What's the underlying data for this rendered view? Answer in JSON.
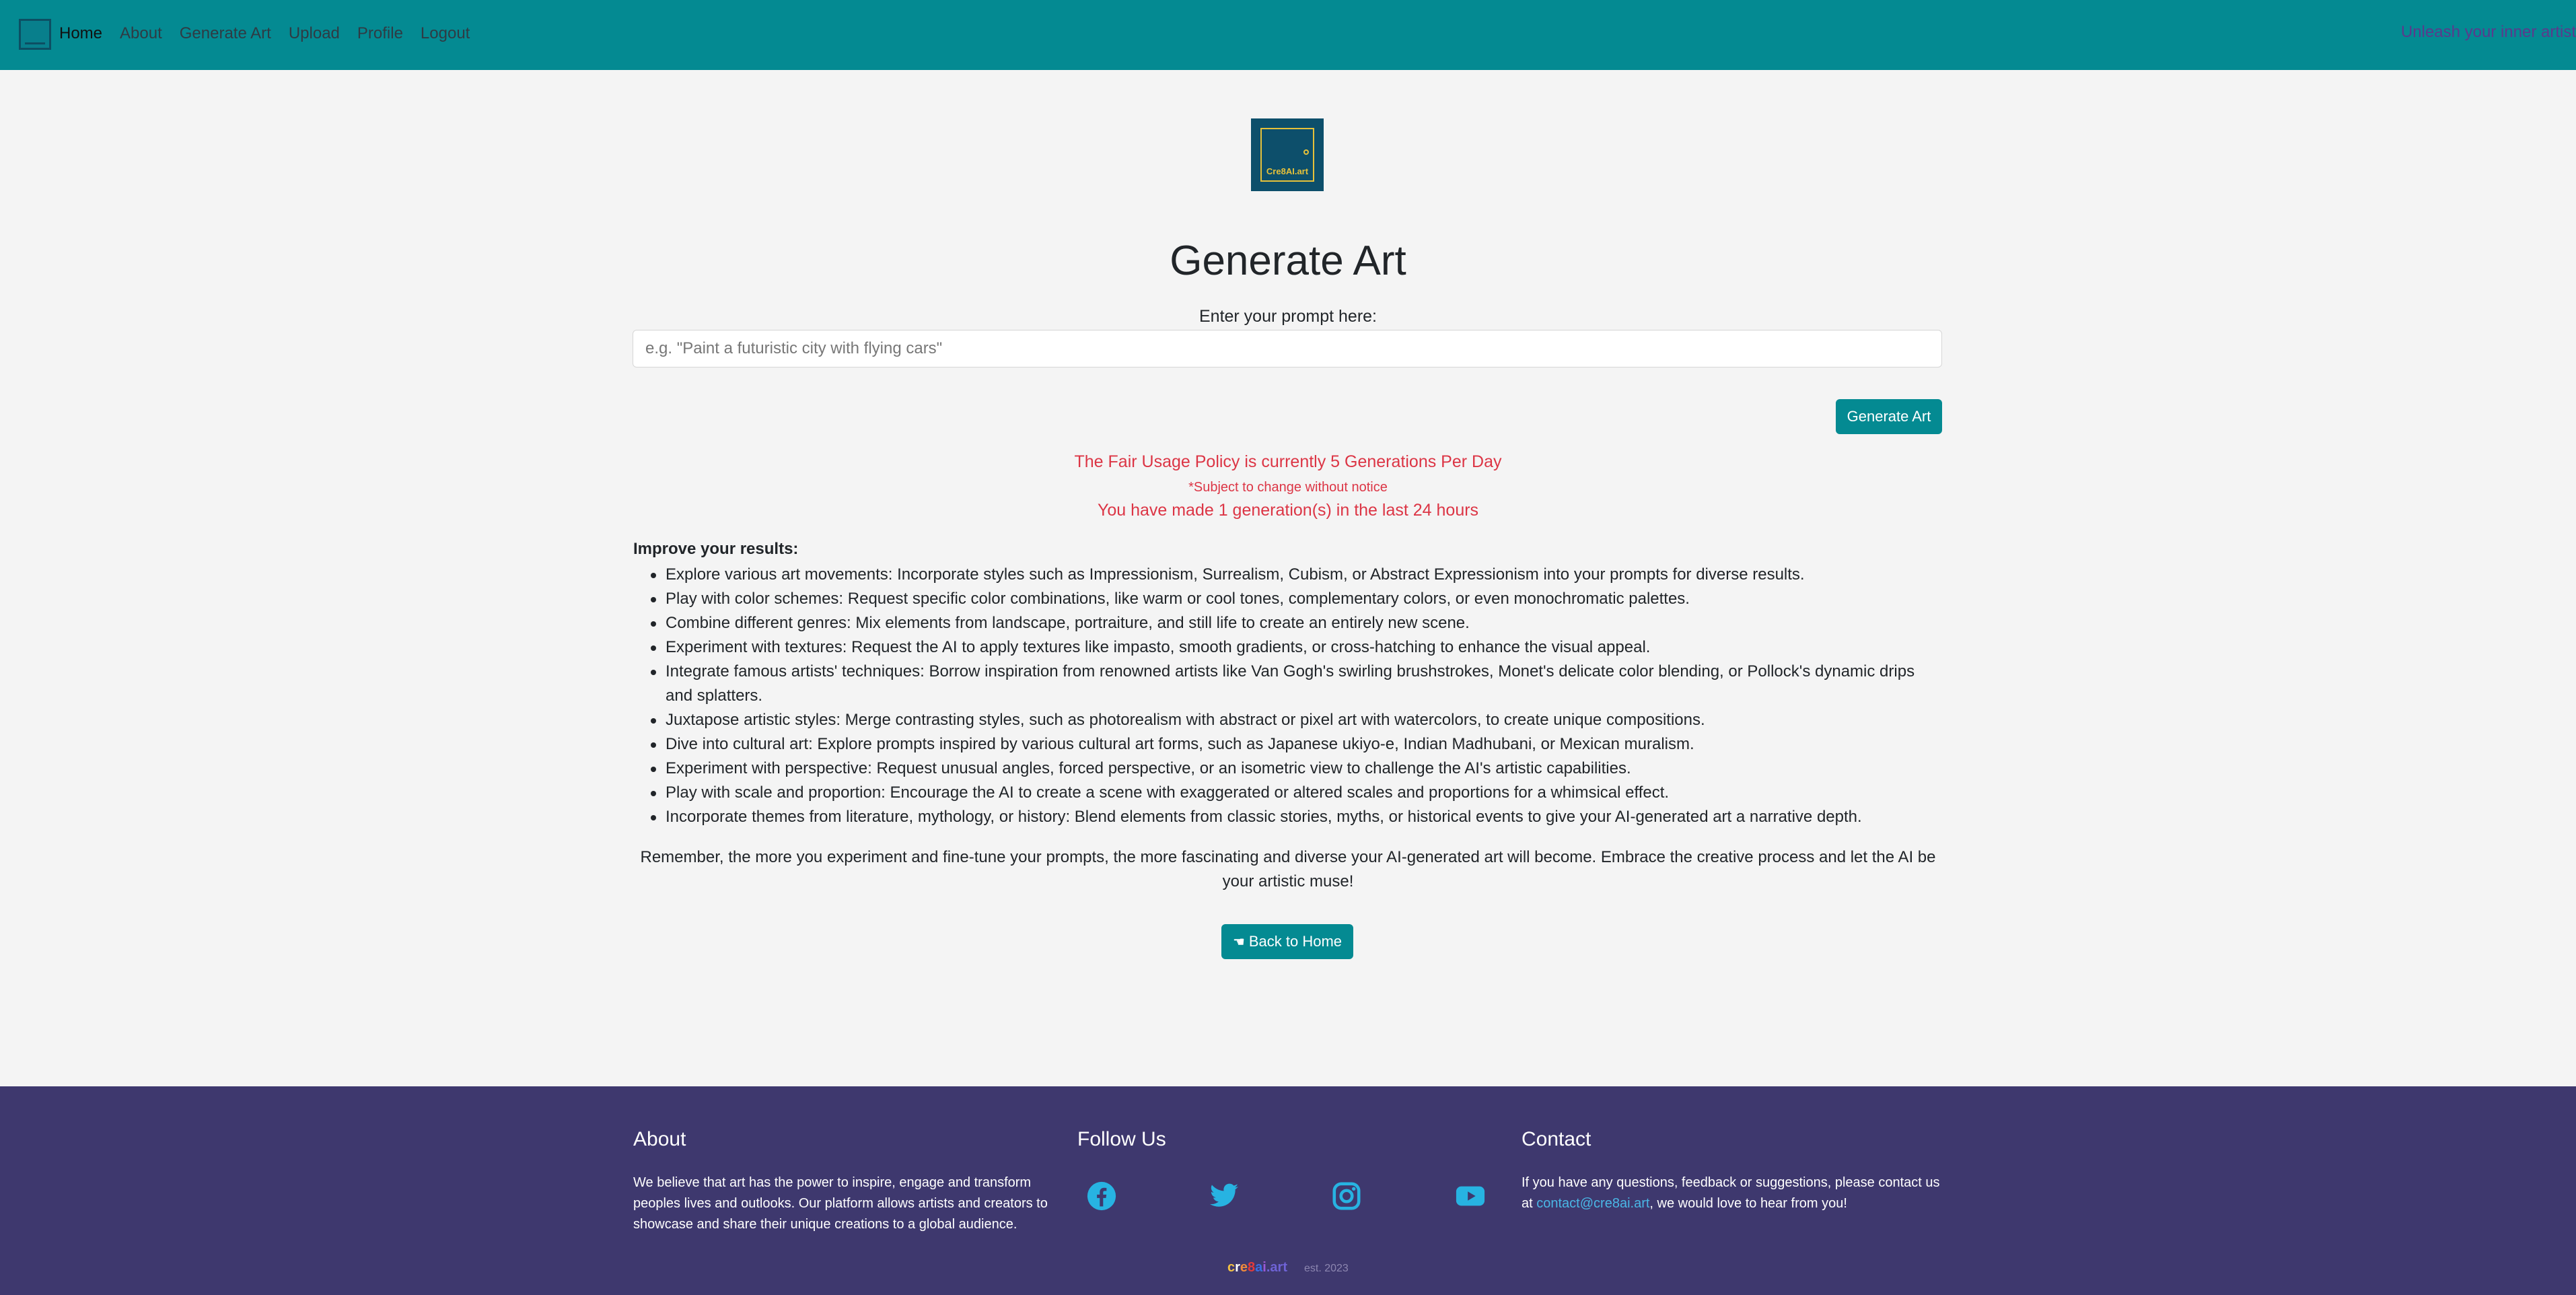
{
  "nav": {
    "links": [
      "Home",
      "About",
      "Generate Art",
      "Upload",
      "Profile",
      "Logout"
    ],
    "tagline": "Unleash your inner artist"
  },
  "logo": {
    "text": "Cre8AI.art"
  },
  "main": {
    "title": "Generate Art",
    "prompt_label": "Enter your prompt here:",
    "prompt_placeholder": "e.g. \"Paint a futuristic city with flying cars\"",
    "prompt_value": "",
    "generate_button": "Generate Art",
    "policy_line1": "The Fair Usage Policy is currently 5 Generations Per Day",
    "policy_line2": "*Subject to change without notice",
    "policy_line3": "You have made 1 generation(s) in the last 24 hours",
    "improve_title": "Improve your results:",
    "tips": [
      "Explore various art movements: Incorporate styles such as Impressionism, Surrealism, Cubism, or Abstract Expressionism into your prompts for diverse results.",
      "Play with color schemes: Request specific color combinations, like warm or cool tones, complementary colors, or even monochromatic palettes.",
      "Combine different genres: Mix elements from landscape, portraiture, and still life to create an entirely new scene.",
      "Experiment with textures: Request the AI to apply textures like impasto, smooth gradients, or cross-hatching to enhance the visual appeal.",
      "Integrate famous artists' techniques: Borrow inspiration from renowned artists like Van Gogh's swirling brushstrokes, Monet's delicate color blending, or Pollock's dynamic drips and splatters.",
      "Juxtapose artistic styles: Merge contrasting styles, such as photorealism with abstract or pixel art with watercolors, to create unique compositions.",
      "Dive into cultural art: Explore prompts inspired by various cultural art forms, such as Japanese ukiyo-e, Indian Madhubani, or Mexican muralism.",
      "Experiment with perspective: Request unusual angles, forced perspective, or an isometric view to challenge the AI's artistic capabilities.",
      "Play with scale and proportion: Encourage the AI to create a scene with exaggerated or altered scales and proportions for a whimsical effect.",
      "Incorporate themes from literature, mythology, or history: Blend elements from classic stories, myths, or historical events to give your AI-generated art a narrative depth."
    ],
    "remember": "Remember, the more you experiment and fine-tune your prompts, the more fascinating and diverse your AI-generated art will become. Embrace the creative process and let the AI be your artistic muse!",
    "back_button": "Back to Home"
  },
  "footer": {
    "about_title": "About",
    "about_text": "We believe that art has the power to inspire, engage and transform peoples lives and outlooks. Our platform allows artists and creators to showcase and share their unique creations to a global audience.",
    "follow_title": "Follow Us",
    "social_icons": [
      "facebook-icon",
      "twitter-icon",
      "instagram-icon",
      "youtube-icon"
    ],
    "contact_title": "Contact",
    "contact_text_before": "If you have any questions, feedback or suggestions, please contact us at ",
    "contact_email": "contact@cre8ai.art",
    "contact_text_after": ", we would love to hear from you!",
    "brand": {
      "c": "c",
      "r": "r",
      "e": "e",
      "eight": "8",
      "a": "a",
      "i": "i",
      "dot": ".",
      "art": "art"
    },
    "est": "est. 2023"
  },
  "colors": {
    "navbar": "#048a92",
    "button": "#048a92",
    "policy_text": "#dc3545",
    "footer_bg": "#3e386e",
    "social": "#27b3e2",
    "link": "#4ab7e6"
  }
}
